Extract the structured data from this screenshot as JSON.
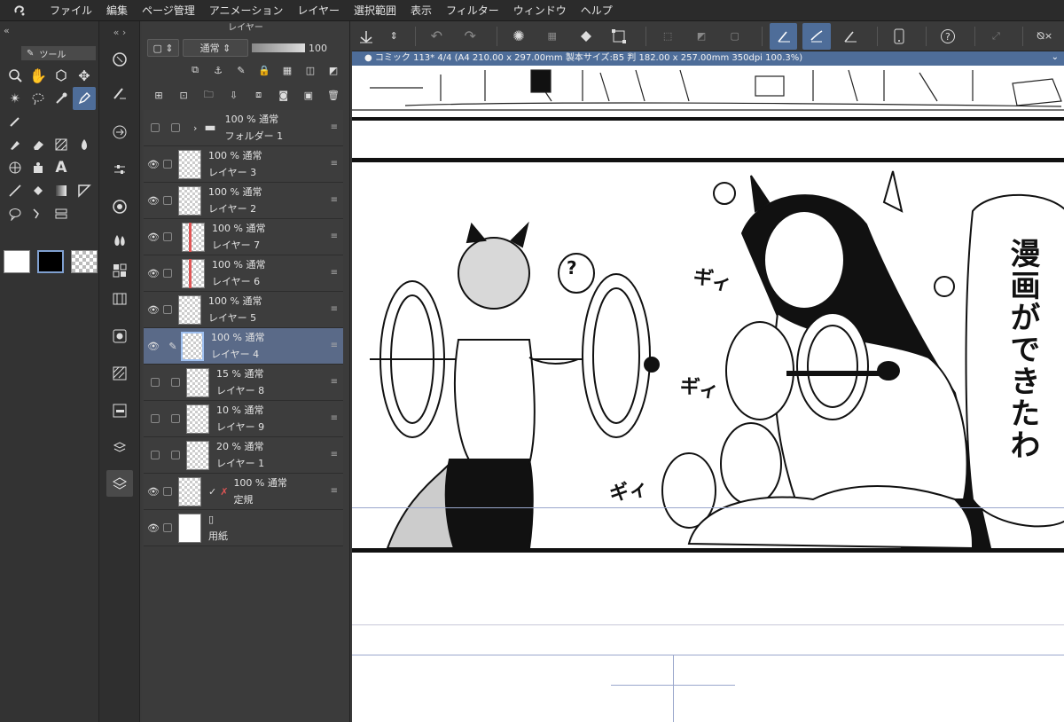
{
  "menubar": {
    "items": [
      "ファイル",
      "編集",
      "ページ管理",
      "アニメーション",
      "レイヤー",
      "選択範囲",
      "表示",
      "フィルター",
      "ウィンドウ",
      "ヘルプ"
    ]
  },
  "tool_panel": {
    "tab_label": "ツール"
  },
  "layer_panel": {
    "title": "レイヤー",
    "blend_mode": "通常",
    "opacity": "100",
    "layers": [
      {
        "line1": "100 % 通常",
        "line2": "フォルダー 1",
        "visible": false,
        "type": "folder"
      },
      {
        "line1": "100 % 通常",
        "line2": "レイヤー 3",
        "visible": true
      },
      {
        "line1": "100 % 通常",
        "line2": "レイヤー 2",
        "visible": true
      },
      {
        "line1": "100 % 通常",
        "line2": "レイヤー 7",
        "visible": true,
        "red": true
      },
      {
        "line1": "100 % 通常",
        "line2": "レイヤー 6",
        "visible": true,
        "red": true
      },
      {
        "line1": "100 % 通常",
        "line2": "レイヤー 5",
        "visible": true
      },
      {
        "line1": "100 % 通常",
        "line2": "レイヤー 4",
        "visible": true,
        "selected": true
      },
      {
        "line1": "15 % 通常",
        "line2": "レイヤー 8",
        "visible": false
      },
      {
        "line1": "10 % 通常",
        "line2": "レイヤー 9",
        "visible": false
      },
      {
        "line1": "20 % 通常",
        "line2": "レイヤー 1",
        "visible": false
      },
      {
        "line1": "100 % 通常",
        "line2": "定規",
        "visible": true,
        "ruler": true
      },
      {
        "line1": "",
        "line2": "用紙",
        "visible": true,
        "paper": true
      }
    ]
  },
  "document": {
    "tab_title": "コミック 113* 4/4 (A4 210.00 x 297.00mm 製本サイズ:B5 判 182.00 x 257.00mm 350dpi 100.3%)"
  },
  "canvas_text": {
    "speech": "漫画ができたわ",
    "question": "?",
    "sfx1": "ギィ",
    "sfx2": "ギィ",
    "sfx3": "ギィ"
  },
  "colors": {
    "accent": "#4e6d99",
    "red_mark": "#e05555"
  }
}
